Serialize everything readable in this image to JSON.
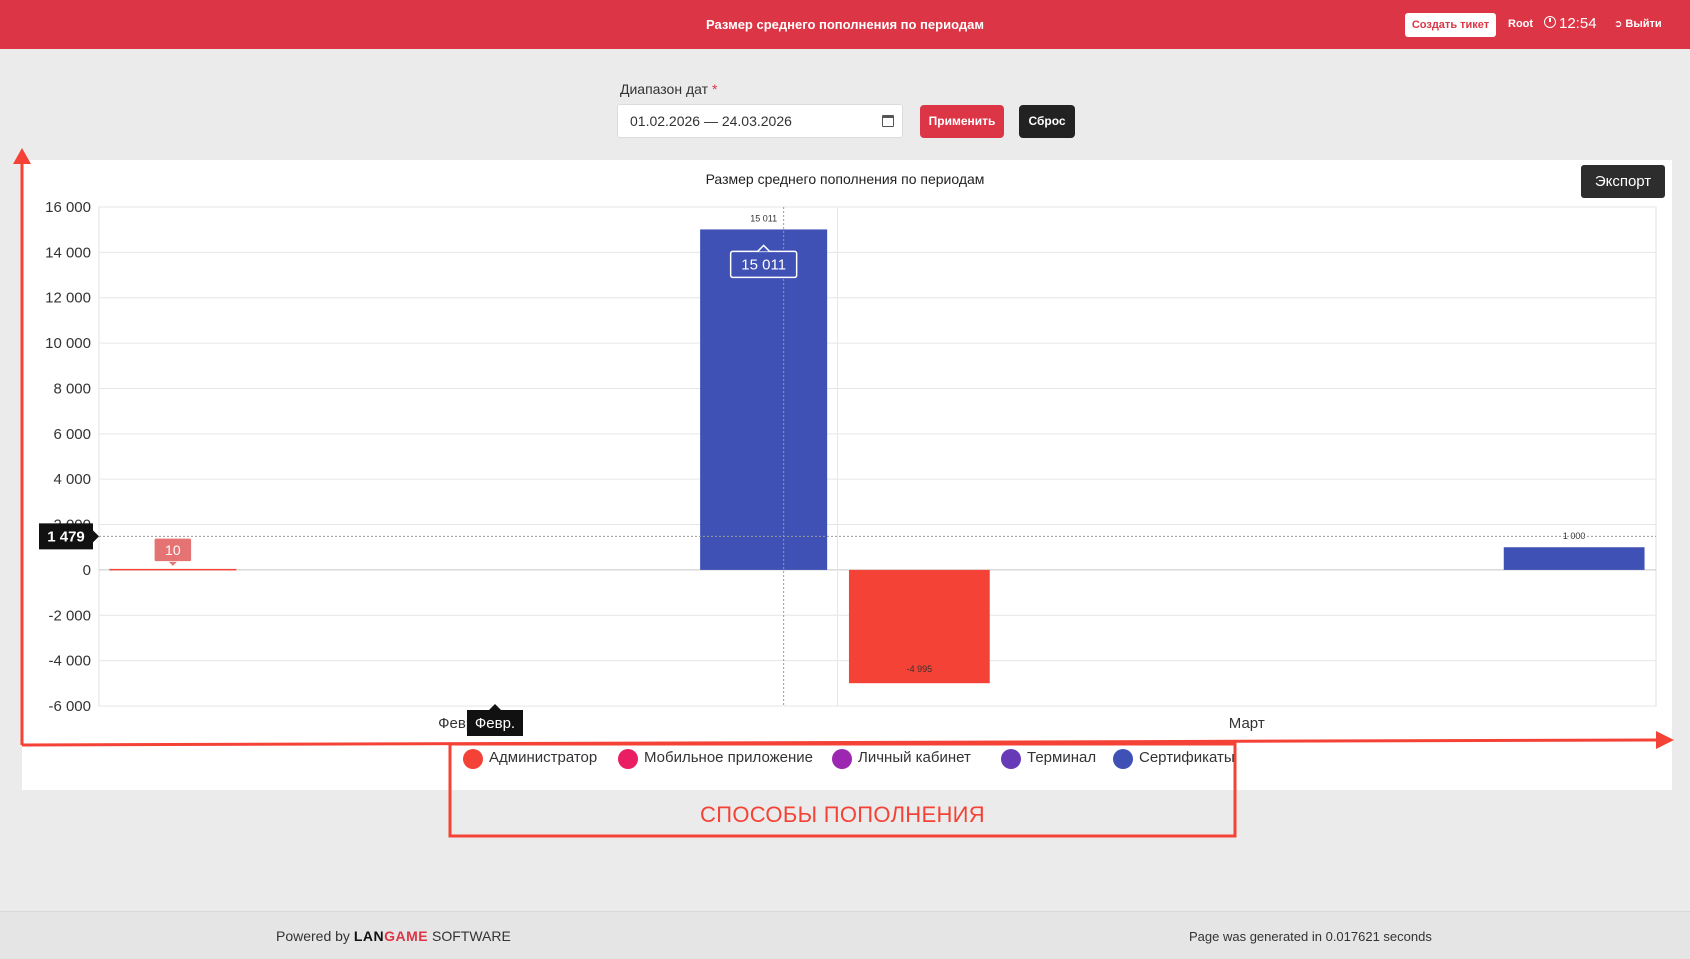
{
  "header": {
    "title": "Размер среднего пополнения по периодам",
    "ticket_button": "Создать тикет",
    "user": "Root",
    "time": "12:54",
    "logout": "Выйти"
  },
  "filters": {
    "date_label": "Диапазон дат",
    "required_mark": "*",
    "date_value": "01.02.2026 — 24.03.2026",
    "apply_label": "Применить",
    "reset_label": "Сброс"
  },
  "export_label": "Экспорт",
  "legend": [
    {
      "label": "Администратор",
      "color": "#f44336"
    },
    {
      "label": "Мобильное приложение",
      "color": "#e91e63"
    },
    {
      "label": "Личный кабинет",
      "color": "#9c27b0"
    },
    {
      "label": "Терминал",
      "color": "#673ab7"
    },
    {
      "label": "Сертификаты",
      "color": "#3f51b5"
    }
  ],
  "annotation": {
    "legend_caption": "СПОСОБЫ ПОПОЛНЕНИЯ",
    "color": "#f44336"
  },
  "chart_data": {
    "type": "bar",
    "title": "Размер среднего пополнения по периодам",
    "categories": [
      "Февр.",
      "Март"
    ],
    "ylim": [
      -6000,
      16000
    ],
    "yticks": [
      16000,
      14000,
      12000,
      10000,
      8000,
      6000,
      4000,
      2000,
      0,
      -2000,
      -4000,
      -6000
    ],
    "ytick_labels": [
      "16 000",
      "14 000",
      "12 000",
      "10 000",
      "8 000",
      "6 000",
      "4 000",
      "2 000",
      "0",
      "-2 000",
      "-4 000",
      "-6 000"
    ],
    "grid": true,
    "series": [
      {
        "name": "Администратор",
        "color": "#f44336",
        "values": [
          10,
          -4995
        ],
        "labels": [
          "10",
          "-4 995"
        ]
      },
      {
        "name": "Мобильное приложение",
        "color": "#e91e63",
        "values": [
          null,
          null
        ],
        "labels": [
          "",
          ""
        ]
      },
      {
        "name": "Личный кабинет",
        "color": "#9c27b0",
        "values": [
          null,
          null
        ],
        "labels": [
          "",
          ""
        ]
      },
      {
        "name": "Терминал",
        "color": "#673ab7",
        "values": [
          null,
          null
        ],
        "labels": [
          "",
          ""
        ]
      },
      {
        "name": "Сертификаты",
        "color": "#3f51b5",
        "values": [
          15011,
          1000
        ],
        "labels": [
          "15 011",
          "1 000"
        ]
      }
    ],
    "crosshair": {
      "y_value": 1479,
      "y_label": "1 479",
      "x_label": "Февр.",
      "tooltips": [
        {
          "series": "Сертификаты",
          "category": "Февр.",
          "label": "15 011"
        },
        {
          "series": "Администратор",
          "category": "Февр.",
          "label": "10"
        }
      ]
    }
  },
  "footer": {
    "powered_prefix": "Powered by",
    "brand_lan": "LAN",
    "brand_game": "GAME",
    "brand_suffix": "SOFTWARE",
    "generated": "Page was generated in 0.017621 seconds"
  }
}
